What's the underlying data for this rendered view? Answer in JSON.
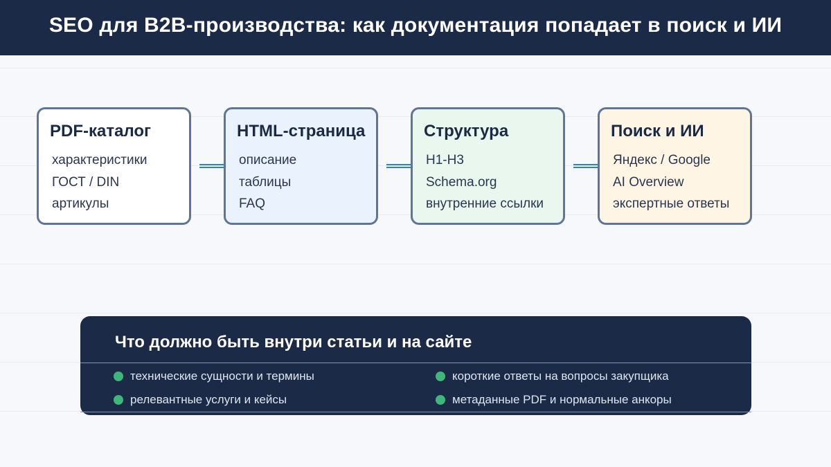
{
  "header": {
    "title": "SEO для B2B-производства: как документация попадает в поиск и ИИ"
  },
  "colors": {
    "header_bg": "#1b2a47",
    "card_border": "#5d7596",
    "connector": "#2f7fd0",
    "bullet": "#3fb67a"
  },
  "stages": [
    {
      "title": "PDF-каталог",
      "color": "#ffffff",
      "items": [
        "характеристики",
        "ГОСТ / DIN",
        "артикулы"
      ]
    },
    {
      "title": "HTML-страница",
      "color": "#eaf2fe",
      "items": [
        "описание",
        "таблицы",
        "FAQ"
      ]
    },
    {
      "title": "Структура",
      "color": "#e9f7ee",
      "items": [
        "H1-H3",
        "Schema.org",
        "внутренние ссылки"
      ]
    },
    {
      "title": "Поиск и ИИ",
      "color": "#fff5e5",
      "items": [
        "Яндекс / Google",
        "AI Overview",
        "экспертные ответы"
      ]
    }
  ],
  "panel": {
    "title": "Что должно быть внутри статьи и на сайте",
    "points": [
      "технические сущности и термины",
      "короткие ответы на вопросы закупщика",
      "релевантные услуги и кейсы",
      "метаданные PDF и нормальные анкоры"
    ]
  }
}
